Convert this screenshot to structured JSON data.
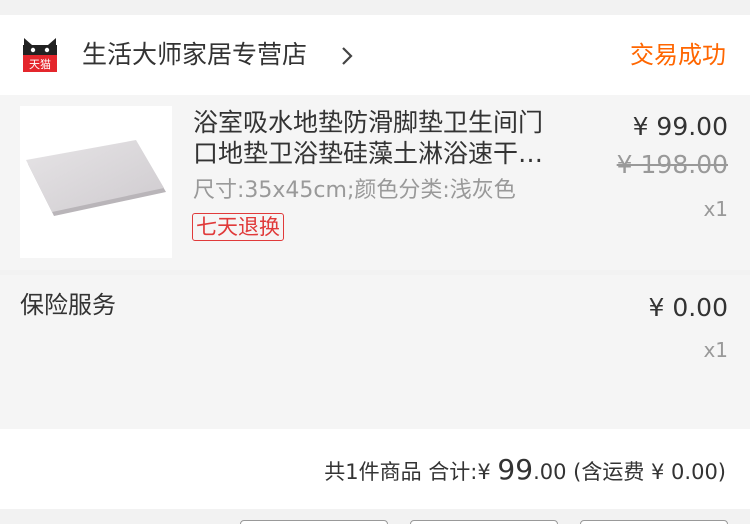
{
  "store": {
    "logo_icon": "tmall-cat-icon",
    "logo_text": "天猫",
    "name": "生活大师家居专营店",
    "status": "交易成功",
    "status_color": "#ff6600"
  },
  "product": {
    "title_line_1": "浴室吸水地垫防滑脚垫卫生间门",
    "title_line_2": "口地垫卫浴垫硅藻土淋浴速干…",
    "sku": "尺寸:35x45cm;颜色分类:浅灰色",
    "tag": "七天退换",
    "price": "¥ 99.00",
    "original_price": "¥ 198.00",
    "quantity": "x1"
  },
  "insurance": {
    "label": "保险服务",
    "price": "¥ 0.00",
    "quantity": "x1"
  },
  "total": {
    "prefix": "共1件商品 合计:",
    "currency": "¥ ",
    "amount_int": "99",
    "amount_dec": ".00",
    "shipping": " (含运费 ¥ 0.00)"
  },
  "colors": {
    "accent": "#ff6600",
    "tag_red": "#e03a3a"
  }
}
